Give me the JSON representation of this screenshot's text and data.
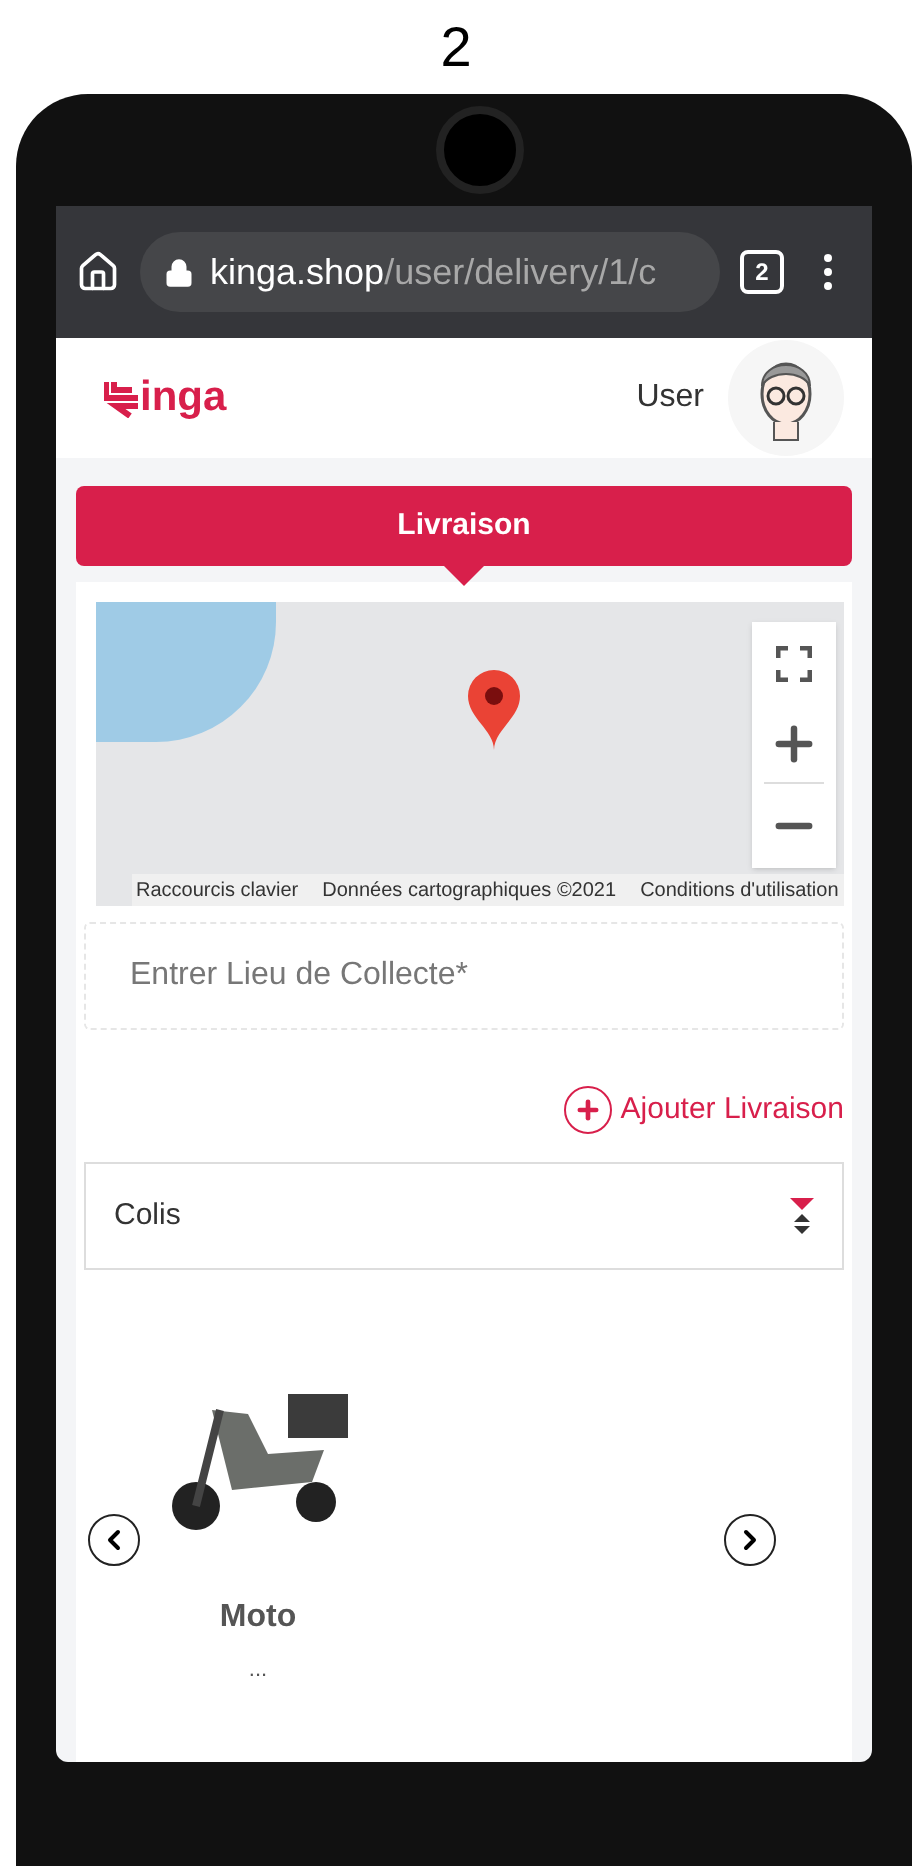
{
  "caption": "2",
  "browser": {
    "url_host": "kinga.shop",
    "url_path": "/user/delivery/1/c",
    "tab_count": "2"
  },
  "header": {
    "logo_text": "inga",
    "user": "User"
  },
  "tabs": [
    {
      "label": "Livraison",
      "selected": true
    }
  ],
  "map": {
    "attribution": [
      "Raccourcis clavier",
      "Données cartographiques ©2021",
      "Conditions d'utilisation"
    ]
  },
  "pickup": {
    "placeholder": "Entrer Lieu de Collecte*"
  },
  "add_delivery": "Ajouter Livraison",
  "package_select": {
    "value": "Colis"
  },
  "vehicles": [
    {
      "name": "Moto",
      "description": "..."
    }
  ]
}
